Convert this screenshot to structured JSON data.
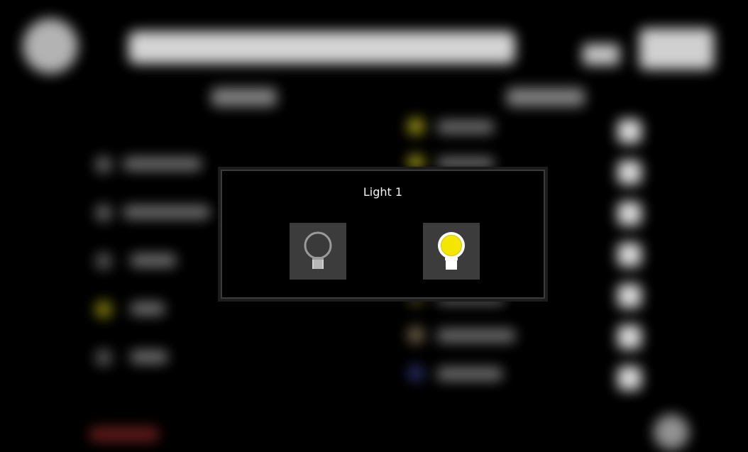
{
  "dialog": {
    "title": "Light 1",
    "buttons": [
      {
        "name": "light-off-button",
        "icon": "bulb-off-icon",
        "state": "off"
      },
      {
        "name": "light-on-button",
        "icon": "bulb-on-icon",
        "state": "on"
      }
    ]
  },
  "colors": {
    "bulb_on": "#f5e600",
    "bulb_off": "#3a3a3a",
    "button_bg": "#3c3c3c",
    "dialog_border": "#3b3b3b"
  }
}
